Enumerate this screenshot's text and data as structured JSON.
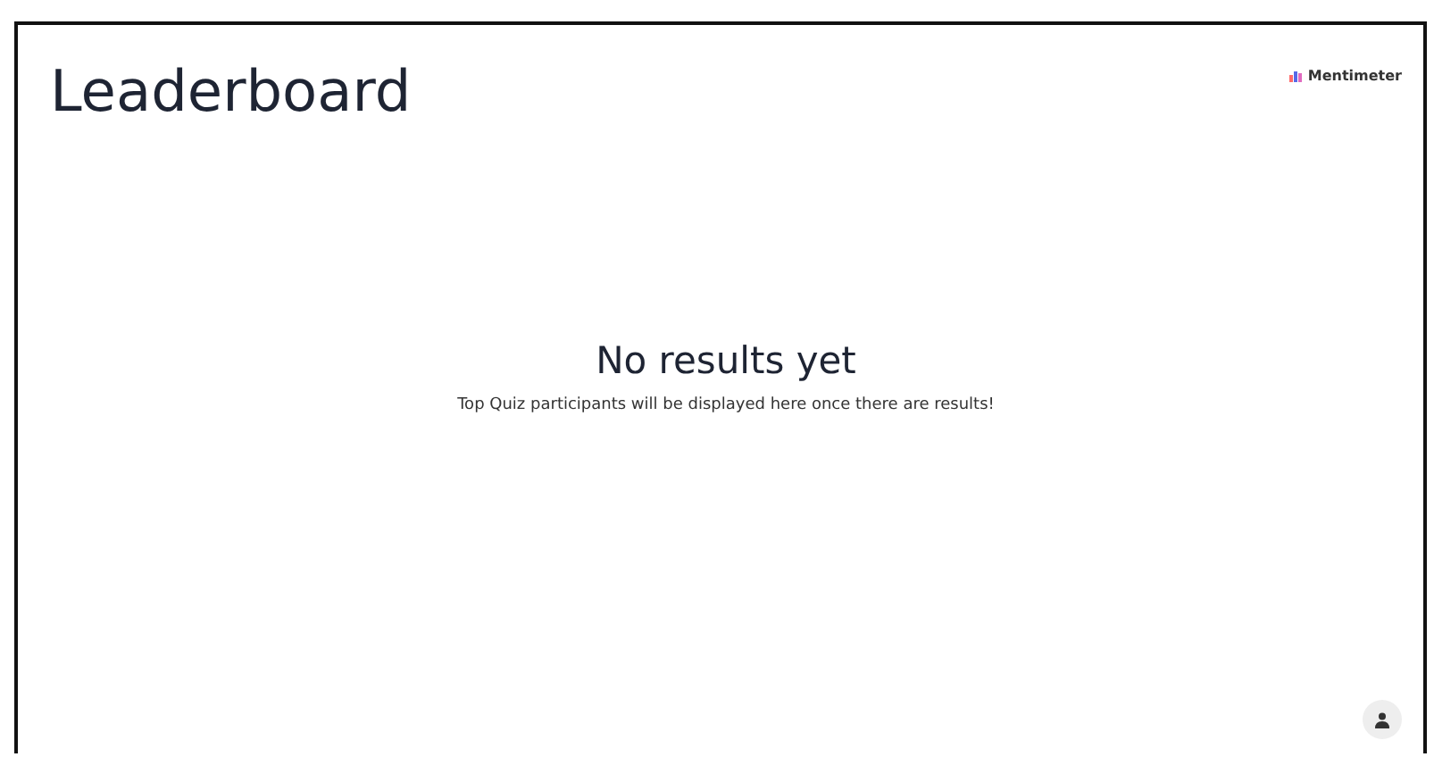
{
  "title": "Leaderboard",
  "brand": "Mentimeter",
  "empty_state": {
    "heading": "No results yet",
    "message": "Top Quiz participants will be displayed here once there are results!"
  }
}
